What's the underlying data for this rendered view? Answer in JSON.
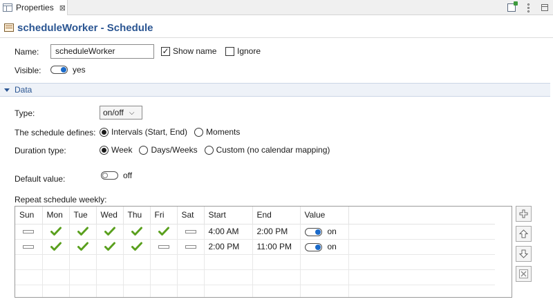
{
  "tab": {
    "label": "Properties",
    "close_glyph": "⊠"
  },
  "header": {
    "title": "scheduleWorker - Schedule",
    "icon": "schedule-icon"
  },
  "form": {
    "name_label": "Name:",
    "name_value": "scheduleWorker",
    "show_name_label": "Show name",
    "show_name_checked": true,
    "ignore_label": "Ignore",
    "ignore_checked": false,
    "visible_label": "Visible:",
    "visible_value": "yes"
  },
  "section": {
    "title": "Data"
  },
  "data": {
    "type_label": "Type:",
    "type_value": "on/off",
    "defines_label": "The schedule defines:",
    "defines_options": [
      "Intervals (Start, End)",
      "Moments"
    ],
    "defines_selected": "Intervals (Start, End)",
    "duration_label": "Duration type:",
    "duration_options": [
      "Week",
      "Days/Weeks",
      "Custom (no calendar mapping)"
    ],
    "duration_selected": "Week",
    "default_label": "Default value:",
    "default_value": "off",
    "repeat_label": "Repeat schedule weekly:"
  },
  "table": {
    "columns": [
      "Sun",
      "Mon",
      "Tue",
      "Wed",
      "Thu",
      "Fri",
      "Sat",
      "Start",
      "End",
      "Value"
    ],
    "rows": [
      {
        "days": [
          false,
          true,
          true,
          true,
          true,
          true,
          false
        ],
        "start": "4:00 AM",
        "end": "2:00 PM",
        "value": "on"
      },
      {
        "days": [
          false,
          true,
          true,
          true,
          true,
          false,
          false
        ],
        "start": "2:00 PM",
        "end": "11:00 PM",
        "value": "on"
      }
    ]
  },
  "side_buttons": [
    "add-row-icon",
    "move-up-icon",
    "move-down-icon",
    "delete-row-icon"
  ],
  "colors": {
    "title": "#2a5592",
    "check_green": "#5aa01e",
    "toggle_on": "#1b6ac9"
  }
}
